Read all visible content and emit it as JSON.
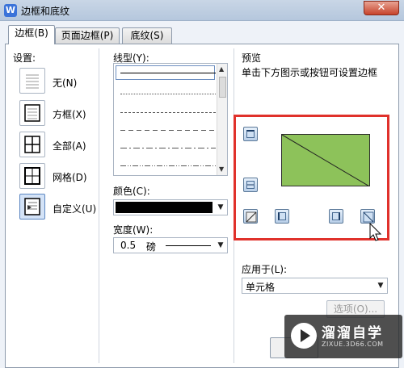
{
  "window": {
    "title": "边框和底纹",
    "app_icon": "W",
    "close": "✕"
  },
  "tabs": [
    {
      "label": "边框(B)",
      "active": true
    },
    {
      "label": "页面边框(P)",
      "active": false
    },
    {
      "label": "底纹(S)",
      "active": false
    }
  ],
  "settings": {
    "label": "设置:",
    "items": [
      {
        "label": "无(N)",
        "icon": "no-border-icon",
        "selected": false
      },
      {
        "label": "方框(X)",
        "icon": "box-border-icon",
        "selected": false
      },
      {
        "label": "全部(A)",
        "icon": "all-borders-icon",
        "selected": false
      },
      {
        "label": "网格(D)",
        "icon": "grid-border-icon",
        "selected": false
      },
      {
        "label": "自定义(U)",
        "icon": "custom-border-icon",
        "selected": true
      }
    ]
  },
  "line_style": {
    "label": "线型(Y):",
    "options": [
      "solid",
      "dotted",
      "dashed",
      "dashed-long",
      "dash-dot",
      "dash-dot-dot"
    ],
    "selected": "solid"
  },
  "color": {
    "label": "颜色(C):",
    "value": "#000000"
  },
  "width": {
    "label": "宽度(W):",
    "value": "0.5",
    "unit": "磅"
  },
  "preview": {
    "label": "预览",
    "hint": "单击下方图示或按钮可设置边框",
    "cell_color": "#8dc25a",
    "highlight_color": "#e0312b"
  },
  "apply_to": {
    "label": "应用于(L):",
    "value": "单元格"
  },
  "options_button": "选项(O)...",
  "watermark": {
    "title": "溜溜自学",
    "subtitle": "ZIXUE.3D66.COM"
  }
}
